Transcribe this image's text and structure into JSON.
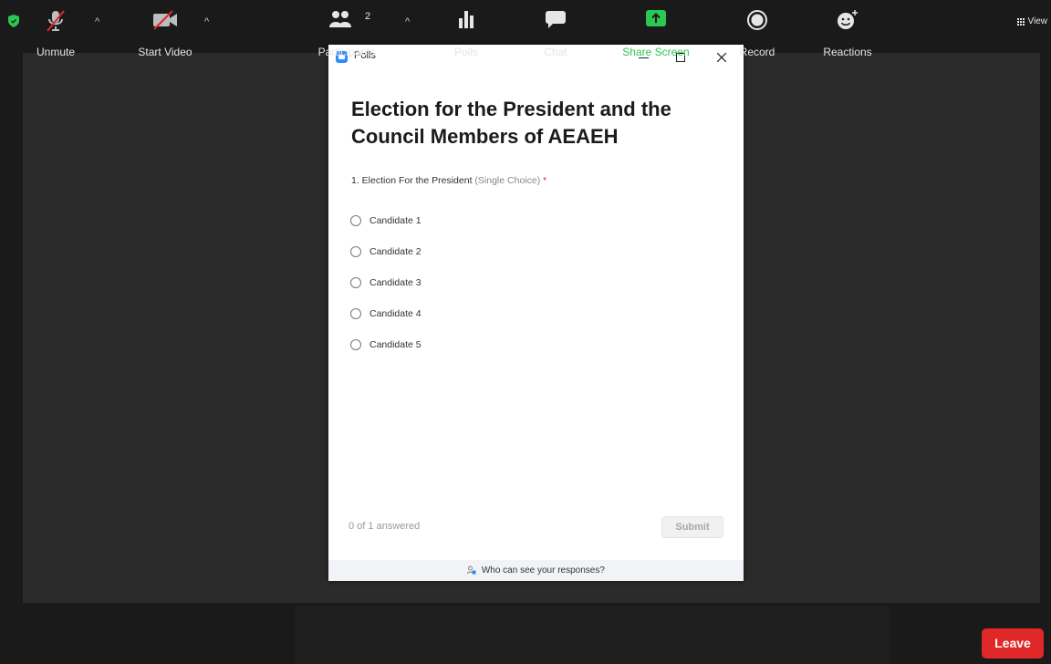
{
  "topbar": {
    "view_label": "View"
  },
  "poll": {
    "window_title": "Polls",
    "title": "Election for the President and the Council Members of AEAEH",
    "question": {
      "text": "1. Election For the President",
      "type": "(Single Choice)",
      "required_mark": "*"
    },
    "options": [
      "Candidate 1",
      "Candidate 2",
      "Candidate 3",
      "Candidate 4",
      "Candidate 5"
    ],
    "status": "0 of 1 answered",
    "submit_label": "Submit",
    "footer_text": "Who can see your responses?"
  },
  "toolbar": {
    "unmute": "Unmute",
    "start_video": "Start Video",
    "participants": "Participants",
    "participants_count": "2",
    "polls": "Polls",
    "chat": "Chat",
    "share_screen": "Share Screen",
    "record": "Record",
    "reactions": "Reactions",
    "leave": "Leave"
  },
  "colors": {
    "share_green": "#2cc650",
    "leave_red": "#e02828",
    "zoom_blue": "#2d8cff"
  }
}
